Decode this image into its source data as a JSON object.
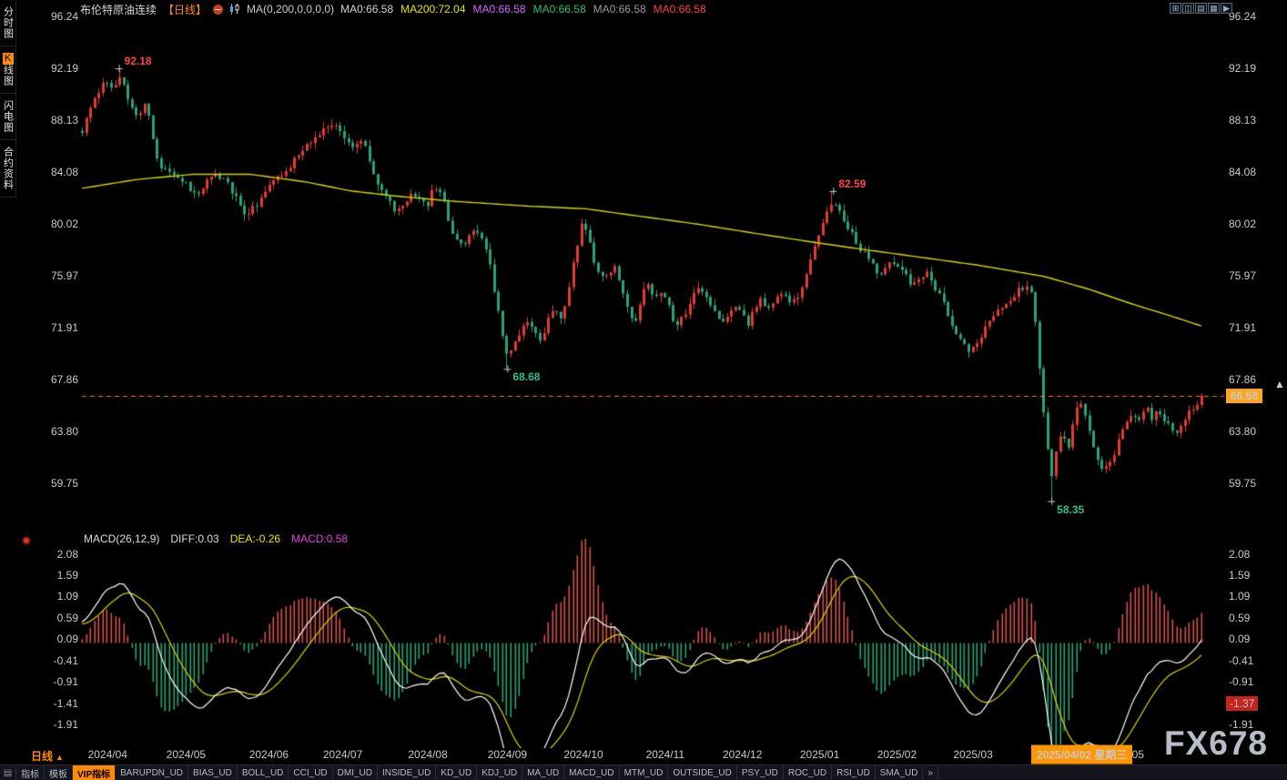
{
  "header": {
    "title": "布伦特原油连续",
    "period_tag": "【日线】",
    "ma_settings": "MA(0,200,0,0,0,0)",
    "ma_values": [
      {
        "text": "MA0:66.58",
        "color": "#d2d2d2"
      },
      {
        "text": "MA200:72.04",
        "color": "#e6e600"
      },
      {
        "text": "MA0:66.58",
        "color": "#d465ff"
      },
      {
        "text": "MA0:66.58",
        "color": "#2fbf6f"
      },
      {
        "text": "MA0:66.58",
        "color": "#9a9aa2"
      },
      {
        "text": "MA0:66.58",
        "color": "#ff4339"
      }
    ],
    "window_icons": [
      {
        "glyph": "⊞",
        "name": "layout-grid-icon"
      },
      {
        "glyph": "◫",
        "name": "split-horizontal-icon"
      },
      {
        "glyph": "▤",
        "name": "rows-panel-icon"
      },
      {
        "glyph": "▦",
        "name": "grid-panel-icon"
      },
      {
        "glyph": "▶",
        "name": "collapse-right-icon"
      }
    ]
  },
  "sidebar": {
    "items": [
      {
        "label": "分时图",
        "id": "time-chart",
        "active": false
      },
      {
        "label": "K线图",
        "id": "kline-chart",
        "active": true
      },
      {
        "label": "闪电图",
        "id": "flash-chart",
        "active": false
      },
      {
        "label": "合约资料",
        "id": "contract-info",
        "active": false
      }
    ]
  },
  "chart_data": {
    "type": "candlestick",
    "symbol": "布伦特原油连续",
    "period": "日线",
    "y_ticks": [
      "96.24",
      "92.19",
      "88.13",
      "84.08",
      "80.02",
      "75.97",
      "71.91",
      "67.86",
      "63.80",
      "59.75"
    ],
    "x_labels": [
      {
        "text": "2024/04",
        "t": 0.023
      },
      {
        "text": "2024/05",
        "t": 0.093
      },
      {
        "text": "2024/06",
        "t": 0.167
      },
      {
        "text": "2024/07",
        "t": 0.233
      },
      {
        "text": "2024/08",
        "t": 0.309
      },
      {
        "text": "2024/09",
        "t": 0.38
      },
      {
        "text": "2024/10",
        "t": 0.448
      },
      {
        "text": "2024/11",
        "t": 0.521
      },
      {
        "text": "2024/12",
        "t": 0.59
      },
      {
        "text": "2025/01",
        "t": 0.659
      },
      {
        "text": "2025/02",
        "t": 0.728
      },
      {
        "text": "2025/03",
        "t": 0.796
      },
      {
        "text": "/05",
        "t": 0.942
      }
    ],
    "current_price": {
      "value": 66.58,
      "text": "66.58"
    },
    "annotations": [
      {
        "text": "92.18",
        "t": 0.033,
        "price": 92.18,
        "kind": "high",
        "color": "#ff4444"
      },
      {
        "text": "82.59",
        "t": 0.671,
        "price": 82.59,
        "kind": "high",
        "color": "#ff4444"
      },
      {
        "text": "68.68",
        "t": 0.38,
        "price": 68.68,
        "kind": "low",
        "color": "#2fbf8f"
      },
      {
        "text": "58.35",
        "t": 0.866,
        "price": 58.35,
        "kind": "low",
        "color": "#2fbf8f"
      }
    ],
    "candle_count": 270,
    "render_seed": 20250402,
    "colors": {
      "up": "#e23b35",
      "down": "#2aa377",
      "ma200": "#d6d600",
      "diff": "#ffffff",
      "dea": "#d6d600",
      "macd_pos": "#d5504d",
      "macd_neg": "#2aa377",
      "last_line": "#ff7f27"
    },
    "price_keyframes": [
      [
        0.0,
        87.3
      ],
      [
        0.006,
        88.6
      ],
      [
        0.012,
        90.2
      ],
      [
        0.02,
        91.0
      ],
      [
        0.028,
        90.4
      ],
      [
        0.033,
        91.4
      ],
      [
        0.038,
        90.6
      ],
      [
        0.044,
        89.0
      ],
      [
        0.05,
        88.2
      ],
      [
        0.056,
        89.6
      ],
      [
        0.061,
        88.0
      ],
      [
        0.066,
        85.4
      ],
      [
        0.072,
        84.4
      ],
      [
        0.08,
        84.2
      ],
      [
        0.089,
        83.5
      ],
      [
        0.096,
        82.8
      ],
      [
        0.103,
        82.4
      ],
      [
        0.11,
        83.2
      ],
      [
        0.118,
        84.1
      ],
      [
        0.126,
        83.6
      ],
      [
        0.133,
        82.6
      ],
      [
        0.14,
        81.6
      ],
      [
        0.146,
        80.7
      ],
      [
        0.153,
        81.2
      ],
      [
        0.16,
        81.9
      ],
      [
        0.168,
        83.0
      ],
      [
        0.176,
        83.8
      ],
      [
        0.184,
        84.4
      ],
      [
        0.192,
        85.3
      ],
      [
        0.2,
        86.0
      ],
      [
        0.208,
        86.8
      ],
      [
        0.216,
        87.3
      ],
      [
        0.224,
        87.9
      ],
      [
        0.23,
        87.5
      ],
      [
        0.238,
        86.4
      ],
      [
        0.246,
        86.1
      ],
      [
        0.252,
        86.6
      ],
      [
        0.257,
        85.0
      ],
      [
        0.262,
        83.6
      ],
      [
        0.268,
        82.4
      ],
      [
        0.275,
        81.6
      ],
      [
        0.282,
        81.0
      ],
      [
        0.289,
        81.8
      ],
      [
        0.295,
        82.6
      ],
      [
        0.302,
        82.0
      ],
      [
        0.308,
        81.5
      ],
      [
        0.315,
        83.0
      ],
      [
        0.322,
        82.2
      ],
      [
        0.328,
        80.0
      ],
      [
        0.334,
        78.8
      ],
      [
        0.34,
        78.1
      ],
      [
        0.346,
        79.0
      ],
      [
        0.352,
        79.7
      ],
      [
        0.358,
        78.4
      ],
      [
        0.364,
        76.9
      ],
      [
        0.369,
        74.5
      ],
      [
        0.374,
        71.8
      ],
      [
        0.38,
        69.3
      ],
      [
        0.385,
        70.4
      ],
      [
        0.391,
        71.7
      ],
      [
        0.397,
        72.5
      ],
      [
        0.403,
        71.6
      ],
      [
        0.409,
        70.9
      ],
      [
        0.415,
        72.3
      ],
      [
        0.421,
        73.5
      ],
      [
        0.427,
        72.4
      ],
      [
        0.433,
        74.4
      ],
      [
        0.44,
        77.6
      ],
      [
        0.447,
        80.1
      ],
      [
        0.452,
        78.8
      ],
      [
        0.458,
        77.0
      ],
      [
        0.464,
        75.9
      ],
      [
        0.47,
        76.3
      ],
      [
        0.477,
        76.7
      ],
      [
        0.483,
        74.6
      ],
      [
        0.489,
        73.1
      ],
      [
        0.495,
        72.3
      ],
      [
        0.5,
        74.6
      ],
      [
        0.506,
        75.3
      ],
      [
        0.512,
        74.3
      ],
      [
        0.518,
        74.7
      ],
      [
        0.524,
        73.5
      ],
      [
        0.529,
        71.9
      ],
      [
        0.535,
        72.5
      ],
      [
        0.542,
        73.7
      ],
      [
        0.548,
        74.7
      ],
      [
        0.553,
        75.1
      ],
      [
        0.559,
        74.1
      ],
      [
        0.565,
        73.1
      ],
      [
        0.571,
        72.2
      ],
      [
        0.577,
        72.9
      ],
      [
        0.583,
        73.7
      ],
      [
        0.589,
        72.9
      ],
      [
        0.595,
        72.3
      ],
      [
        0.601,
        73.5
      ],
      [
        0.607,
        74.1
      ],
      [
        0.613,
        73.3
      ],
      [
        0.619,
        73.9
      ],
      [
        0.625,
        74.5
      ],
      [
        0.631,
        74.1
      ],
      [
        0.637,
        73.9
      ],
      [
        0.643,
        75.3
      ],
      [
        0.649,
        76.9
      ],
      [
        0.655,
        78.3
      ],
      [
        0.661,
        80.1
      ],
      [
        0.666,
        81.3
      ],
      [
        0.671,
        81.8
      ],
      [
        0.676,
        81.1
      ],
      [
        0.682,
        79.7
      ],
      [
        0.688,
        79.1
      ],
      [
        0.694,
        78.3
      ],
      [
        0.7,
        77.5
      ],
      [
        0.706,
        76.7
      ],
      [
        0.712,
        75.9
      ],
      [
        0.718,
        76.5
      ],
      [
        0.724,
        77.1
      ],
      [
        0.73,
        76.5
      ],
      [
        0.736,
        75.9
      ],
      [
        0.742,
        75.3
      ],
      [
        0.748,
        75.9
      ],
      [
        0.754,
        76.1
      ],
      [
        0.76,
        75.3
      ],
      [
        0.766,
        74.5
      ],
      [
        0.772,
        73.3
      ],
      [
        0.778,
        72.1
      ],
      [
        0.783,
        70.9
      ],
      [
        0.789,
        70.3
      ],
      [
        0.795,
        70.2
      ],
      [
        0.801,
        71.1
      ],
      [
        0.807,
        71.9
      ],
      [
        0.813,
        72.5
      ],
      [
        0.819,
        73.3
      ],
      [
        0.825,
        73.7
      ],
      [
        0.831,
        74.3
      ],
      [
        0.837,
        74.9
      ],
      [
        0.843,
        75.3
      ],
      [
        0.848,
        74.4
      ],
      [
        0.852,
        71.6
      ],
      [
        0.856,
        67.6
      ],
      [
        0.861,
        63.4
      ],
      [
        0.866,
        60.3
      ],
      [
        0.871,
        62.9
      ],
      [
        0.876,
        63.7
      ],
      [
        0.881,
        62.5
      ],
      [
        0.886,
        64.9
      ],
      [
        0.891,
        66.1
      ],
      [
        0.896,
        64.9
      ],
      [
        0.901,
        63.1
      ],
      [
        0.907,
        61.7
      ],
      [
        0.912,
        60.7
      ],
      [
        0.917,
        61.0
      ],
      [
        0.923,
        62.2
      ],
      [
        0.928,
        63.9
      ],
      [
        0.934,
        64.9
      ],
      [
        0.939,
        65.3
      ],
      [
        0.945,
        64.7
      ],
      [
        0.951,
        65.5
      ],
      [
        0.956,
        64.9
      ],
      [
        0.962,
        65.5
      ],
      [
        0.967,
        64.7
      ],
      [
        0.973,
        64.1
      ],
      [
        0.978,
        63.9
      ],
      [
        0.984,
        64.5
      ],
      [
        0.989,
        65.3
      ],
      [
        0.995,
        65.9
      ],
      [
        1.0,
        66.4
      ]
    ],
    "ma200_keyframes": [
      [
        0.0,
        82.8
      ],
      [
        0.05,
        83.5
      ],
      [
        0.1,
        83.9
      ],
      [
        0.15,
        83.9
      ],
      [
        0.2,
        83.3
      ],
      [
        0.24,
        82.6
      ],
      [
        0.28,
        82.2
      ],
      [
        0.33,
        81.8
      ],
      [
        0.4,
        81.4
      ],
      [
        0.45,
        81.2
      ],
      [
        0.5,
        80.6
      ],
      [
        0.55,
        80.0
      ],
      [
        0.6,
        79.3
      ],
      [
        0.66,
        78.5
      ],
      [
        0.7,
        78.0
      ],
      [
        0.75,
        77.4
      ],
      [
        0.8,
        76.8
      ],
      [
        0.86,
        75.9
      ],
      [
        0.9,
        74.9
      ],
      [
        0.94,
        73.7
      ],
      [
        0.97,
        72.9
      ],
      [
        1.0,
        72.04
      ]
    ]
  },
  "macd": {
    "title": "MACD(26,12,9)",
    "diff_label": "DIFF:0.03",
    "dea_label": "DEA:-0.26",
    "macd_label": "MACD:0.58",
    "y_ticks": [
      "2.08",
      "1.59",
      "1.09",
      "0.59",
      "0.09",
      "-0.41",
      "-0.91",
      "-1.41",
      "-1.91"
    ],
    "right_tag": "-1.37"
  },
  "xaxis": {
    "crosshair": "2025/04/02 星期三",
    "crosshair_t": 0.848
  },
  "bottom": {
    "period_label": "日线",
    "period_arrow": "▲",
    "menu_icon": "▤",
    "tabs": [
      {
        "label": "指标",
        "id": "indicators",
        "active": false
      },
      {
        "label": "模板",
        "id": "templates",
        "active": false
      },
      {
        "label": "VIP指标",
        "id": "vip-indicators",
        "active": true
      },
      {
        "label": "BARUPDN_UD",
        "id": "barupdn-ud",
        "active": false
      },
      {
        "label": "BIAS_UD",
        "id": "bias-ud",
        "active": false
      },
      {
        "label": "BOLL_UD",
        "id": "boll-ud",
        "active": false
      },
      {
        "label": "CCI_UD",
        "id": "cci-ud",
        "active": false
      },
      {
        "label": "DMI_UD",
        "id": "dmi-ud",
        "active": false
      },
      {
        "label": "INSIDE_UD",
        "id": "inside-ud",
        "active": false
      },
      {
        "label": "KD_UD",
        "id": "kd-ud",
        "active": false
      },
      {
        "label": "KDJ_UD",
        "id": "kdj-ud",
        "active": false
      },
      {
        "label": "MA_UD",
        "id": "ma-ud",
        "active": false
      },
      {
        "label": "MACD_UD",
        "id": "macd-ud",
        "active": false
      },
      {
        "label": "MTM_UD",
        "id": "mtm-ud",
        "active": false
      },
      {
        "label": "OUTSIDE_UD",
        "id": "outside-ud",
        "active": false
      },
      {
        "label": "PSY_UD",
        "id": "psy-ud",
        "active": false
      },
      {
        "label": "ROC_UD",
        "id": "roc-ud",
        "active": false
      },
      {
        "label": "RSI_UD",
        "id": "rsi-ud",
        "active": false
      },
      {
        "label": "SMA_UD",
        "id": "sma-ud",
        "active": false
      },
      {
        "label": "»",
        "id": "more-indicators",
        "active": false
      }
    ]
  },
  "watermark": "FX678"
}
